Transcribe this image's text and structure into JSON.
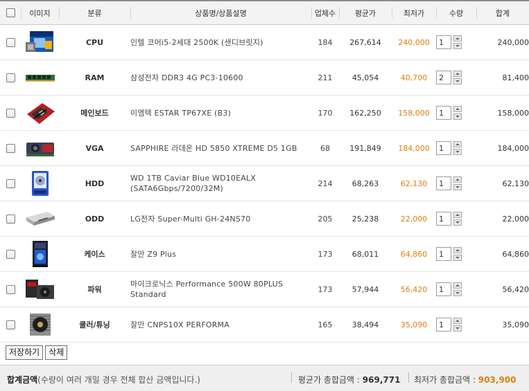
{
  "header": {
    "image": "이미지",
    "category": "분류",
    "product": "상품명/상품설명",
    "vendors": "업체수",
    "avg_price": "평균가",
    "min_price": "최저가",
    "quantity": "수량",
    "total": "합계"
  },
  "rows": [
    {
      "category": "CPU",
      "name": "인텔 코어i5-2세대 2500K (샌디브릿지)",
      "name2": "",
      "vendors": "184",
      "avg": "267,614",
      "min": "240,000",
      "qty": "1",
      "total": "240,000",
      "thumb": "cpu-box"
    },
    {
      "category": "RAM",
      "name": "삼성전자 DDR3 4G PC3-10600",
      "name2": "",
      "vendors": "211",
      "avg": "45,054",
      "min": "40,700",
      "qty": "2",
      "total": "81,400",
      "thumb": "ram-stick"
    },
    {
      "category": "메인보드",
      "name": "이엠텍 ESTAR TP67XE (B3)",
      "name2": "",
      "vendors": "170",
      "avg": "162,250",
      "min": "158,000",
      "qty": "1",
      "total": "158,000",
      "thumb": "motherboard"
    },
    {
      "category": "VGA",
      "name": "SAPPHIRE 라데온 HD 5850 XTREME D5 1GB",
      "name2": "",
      "vendors": "68",
      "avg": "191,849",
      "min": "184,000",
      "qty": "1",
      "total": "184,000",
      "thumb": "graphics-card"
    },
    {
      "category": "HDD",
      "name": "WD 1TB Caviar Blue WD10EALX",
      "name2": "(SATA6Gbps/7200/32M)",
      "vendors": "214",
      "avg": "68,263",
      "min": "62,130",
      "qty": "1",
      "total": "62,130",
      "thumb": "hard-drive"
    },
    {
      "category": "ODD",
      "name": "LG전자 Super-Multi GH-24NS70",
      "name2": "",
      "vendors": "205",
      "avg": "25,238",
      "min": "22,000",
      "qty": "1",
      "total": "22,000",
      "thumb": "optical-drive"
    },
    {
      "category": "케이스",
      "name": "잘만 Z9 Plus",
      "name2": "",
      "vendors": "173",
      "avg": "68,011",
      "min": "64,860",
      "qty": "1",
      "total": "64,860",
      "thumb": "pc-case"
    },
    {
      "category": "파워",
      "name": "마이크로닉스 Performance 500W 80PLUS",
      "name2": "Standard",
      "vendors": "173",
      "avg": "57,944",
      "min": "56,420",
      "qty": "1",
      "total": "56,420",
      "thumb": "power-supply"
    },
    {
      "category": "쿨러/튜닝",
      "name": "잘만 CNPS10X PERFORMA",
      "name2": "",
      "vendors": "165",
      "avg": "38,494",
      "min": "35,090",
      "qty": "1",
      "total": "35,090",
      "thumb": "cpu-cooler"
    }
  ],
  "buttons": {
    "save": "저장하기",
    "delete": "삭제"
  },
  "summary": {
    "label": "합계금액",
    "desc": "(수량이 여러 개일 경우 전체 합산 금액입니다.)",
    "avg_label": "평균가 총합금액 : ",
    "avg_value": "969,771",
    "min_label": "최저가 총합금액 : ",
    "min_value": "903,900"
  },
  "colors": {
    "min_price": "#e07d08",
    "header_bg": "#f3f3f3",
    "summary_bg": "#efefef"
  }
}
